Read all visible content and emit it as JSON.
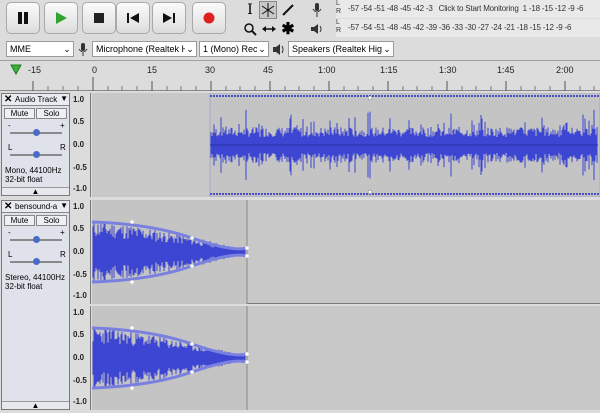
{
  "transport": {
    "pause": "pause-button",
    "play": "play-button",
    "stop": "stop-button",
    "skip_start": "skip-start-button",
    "skip_end": "skip-end-button",
    "record": "record-button"
  },
  "meters": {
    "record": {
      "lr": [
        "L",
        "R"
      ],
      "scale": "-57 -54 -51 -48 -45 -42 -3",
      "prompt": "Click to Start Monitoring",
      "scale_right": "1 -18 -15 -12 -9 -6"
    },
    "play": {
      "lr": [
        "L",
        "R"
      ],
      "scale": "-57 -54 -51 -48 -45 -42 -39 -36 -33 -30 -27 -24 -21 -18 -15 -12 -9 -6"
    }
  },
  "devices": {
    "host": "MME",
    "mic": "Microphone (Realtek Hi",
    "channels": "1 (Mono) Reco",
    "speakers": "Speakers (Realtek High I"
  },
  "ruler": {
    "labels": [
      "-15",
      "0",
      "15",
      "30",
      "45",
      "1:00",
      "1:15",
      "1:30",
      "1:45",
      "2:00"
    ]
  },
  "track1": {
    "name": "Audio Track",
    "mute": "Mute",
    "solo": "Solo",
    "gain_minus": "-",
    "gain_plus": "+",
    "pan_l": "L",
    "pan_r": "R",
    "info1": "Mono, 44100Hz",
    "info2": "32-bit float",
    "scale": [
      "1.0",
      "0.5",
      "0.0",
      "-0.5",
      "-1.0"
    ]
  },
  "track2": {
    "name": "bensound-a",
    "mute": "Mute",
    "solo": "Solo",
    "gain_minus": "-",
    "gain_plus": "+",
    "pan_l": "L",
    "pan_r": "R",
    "info1": "Stereo, 44100Hz",
    "info2": "32-bit float",
    "scale_top": [
      "1.0",
      "0.5",
      "0.0",
      "-0.5",
      "-1.0"
    ],
    "scale_bottom": [
      "1.0",
      "0.5",
      "0.0",
      "-0.5",
      "-1.0"
    ]
  },
  "colors": {
    "wave": "#3c46d2",
    "wave_dark": "#2a30a8",
    "envelope": "#7a80e0",
    "bg": "#c8c8c8"
  }
}
